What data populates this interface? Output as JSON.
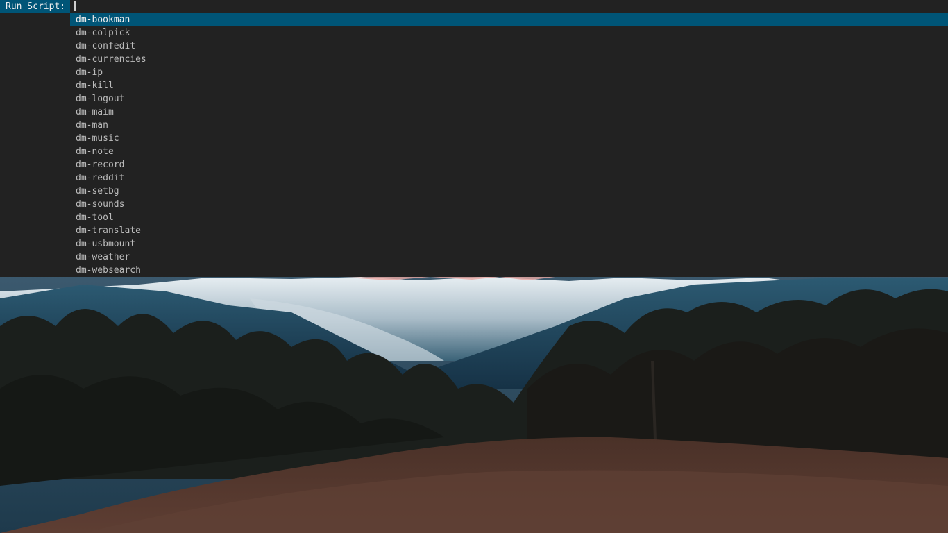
{
  "dmenu": {
    "prompt": "Run Script:",
    "input_value": "",
    "selected_index": 0,
    "items": [
      "dm-bookman",
      "dm-colpick",
      "dm-confedit",
      "dm-currencies",
      "dm-ip",
      "dm-kill",
      "dm-logout",
      "dm-maim",
      "dm-man",
      "dm-music",
      "dm-note",
      "dm-record",
      "dm-reddit",
      "dm-setbg",
      "dm-sounds",
      "dm-tool",
      "dm-translate",
      "dm-usbmount",
      "dm-weather",
      "dm-websearch"
    ],
    "colors": {
      "normal_bg": "#222222",
      "normal_fg": "#bbbbbb",
      "selected_bg": "#005577",
      "selected_fg": "#eeeeee"
    }
  }
}
